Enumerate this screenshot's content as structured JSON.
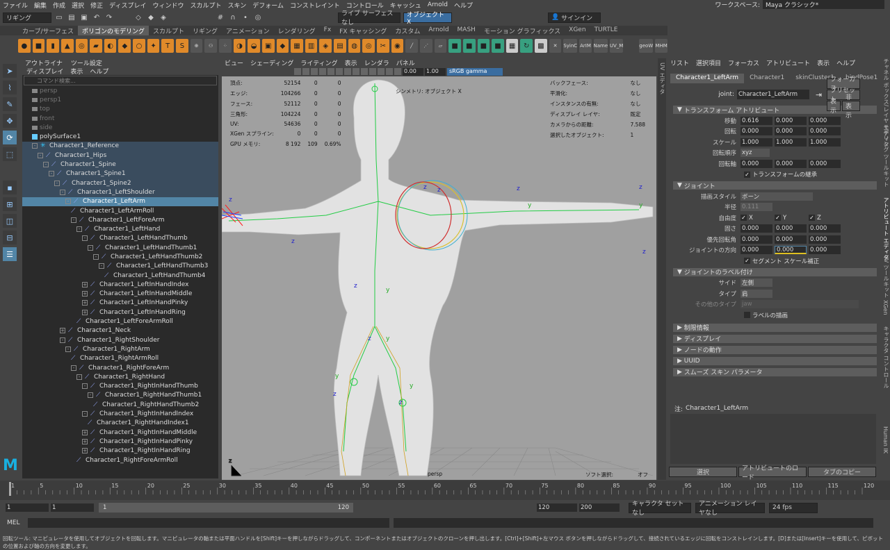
{
  "menubar": {
    "items": [
      "ファイル",
      "編集",
      "作成",
      "選択",
      "修正",
      "ディスプレイ",
      "ウィンドウ",
      "スカルプト",
      "スキン",
      "デフォーム",
      "コンストレイント",
      "コントロール",
      "キャッシュ",
      "Arnold",
      "ヘルプ"
    ],
    "workspace_label": "ワークスペース:",
    "workspace_value": "Maya クラシック*"
  },
  "statusline": {
    "mode": "リギング",
    "live_surface": "ライブ サーフェスなし",
    "symmetry": "オブジェクト X",
    "sign_in": "サインイン"
  },
  "shelf": {
    "tabs": [
      "カーブ/サーフェス",
      "ポリゴンのモデリング",
      "スカルプト",
      "リギング",
      "アニメーション",
      "レンダリング",
      "Fx",
      "FX キャッシング",
      "カスタム",
      "Arnold",
      "MASH",
      "モーション グラフィックス",
      "XGen",
      "TURTLE"
    ],
    "active_tab": "ポリゴンのモデリング",
    "icon_labels": [
      "SyinC",
      "ArIM",
      "Name",
      "UV_M",
      "geoW",
      "MHM"
    ]
  },
  "outliner": {
    "tabs": [
      "アウトライナ",
      "ツール設定"
    ],
    "menu": [
      "ディスプレイ",
      "表示",
      "ヘルプ"
    ],
    "search_placeholder": "コマンド検索...",
    "items": [
      {
        "label": "persp",
        "indent": 0,
        "type": "cam",
        "state": "gray"
      },
      {
        "label": "persp1",
        "indent": 0,
        "type": "cam",
        "state": "gray"
      },
      {
        "label": "top",
        "indent": 0,
        "type": "cam",
        "state": "gray"
      },
      {
        "label": "front",
        "indent": 0,
        "type": "cam",
        "state": "gray"
      },
      {
        "label": "side",
        "indent": 0,
        "type": "cam",
        "state": "gray"
      },
      {
        "label": "polySurface1",
        "indent": 0,
        "type": "mesh",
        "state": ""
      },
      {
        "label": "Character1_Reference",
        "indent": 0,
        "type": "ref",
        "state": "hl",
        "exp": "-"
      },
      {
        "label": "Character1_Hips",
        "indent": 1,
        "type": "jnt",
        "state": "hl",
        "exp": "-"
      },
      {
        "label": "Character1_Spine",
        "indent": 2,
        "type": "jnt",
        "state": "hl",
        "exp": "-"
      },
      {
        "label": "Character1_Spine1",
        "indent": 3,
        "type": "jnt",
        "state": "hl",
        "exp": "-"
      },
      {
        "label": "Character1_Spine2",
        "indent": 4,
        "type": "jnt",
        "state": "hl",
        "exp": "-"
      },
      {
        "label": "Character1_LeftShoulder",
        "indent": 5,
        "type": "jnt",
        "state": "hl",
        "exp": "-"
      },
      {
        "label": "Character1_LeftArm",
        "indent": 6,
        "type": "jnt",
        "state": "sel",
        "exp": "-"
      },
      {
        "label": "Character1_LeftArmRoll",
        "indent": 7,
        "type": "jnt",
        "state": "",
        "exp": ""
      },
      {
        "label": "Character1_LeftForeArm",
        "indent": 7,
        "type": "jnt",
        "state": "",
        "exp": "-"
      },
      {
        "label": "Character1_LeftHand",
        "indent": 8,
        "type": "jnt",
        "state": "",
        "exp": "-"
      },
      {
        "label": "Character1_LeftHandThumb",
        "indent": 9,
        "type": "jnt",
        "state": "",
        "exp": "-"
      },
      {
        "label": "Character1_LeftHandThumb1",
        "indent": 10,
        "type": "jnt",
        "state": "",
        "exp": "-"
      },
      {
        "label": "Character1_LeftHandThumb2",
        "indent": 11,
        "type": "jnt",
        "state": "",
        "exp": "-"
      },
      {
        "label": "Character1_LeftHandThumb3",
        "indent": 12,
        "type": "jnt",
        "state": "",
        "exp": "-"
      },
      {
        "label": "Character1_LeftHandThumb4",
        "indent": 13,
        "type": "jnt",
        "state": "",
        "exp": ""
      },
      {
        "label": "Character1_LeftInHandIndex",
        "indent": 9,
        "type": "jnt",
        "state": "",
        "exp": "+"
      },
      {
        "label": "Character1_LeftInHandMiddle",
        "indent": 9,
        "type": "jnt",
        "state": "",
        "exp": "+"
      },
      {
        "label": "Character1_LeftInHandPinky",
        "indent": 9,
        "type": "jnt",
        "state": "",
        "exp": "+"
      },
      {
        "label": "Character1_LeftInHandRing",
        "indent": 9,
        "type": "jnt",
        "state": "",
        "exp": "+"
      },
      {
        "label": "Character1_LeftForeArmRoll",
        "indent": 8,
        "type": "jnt",
        "state": "",
        "exp": ""
      },
      {
        "label": "Character1_Neck",
        "indent": 5,
        "type": "jnt",
        "state": "",
        "exp": "+"
      },
      {
        "label": "Character1_RightShoulder",
        "indent": 5,
        "type": "jnt",
        "state": "",
        "exp": "-"
      },
      {
        "label": "Character1_RightArm",
        "indent": 6,
        "type": "jnt",
        "state": "",
        "exp": "-"
      },
      {
        "label": "Character1_RightArmRoll",
        "indent": 7,
        "type": "jnt",
        "state": "",
        "exp": ""
      },
      {
        "label": "Character1_RightForeArm",
        "indent": 7,
        "type": "jnt",
        "state": "",
        "exp": "-"
      },
      {
        "label": "Character1_RightHand",
        "indent": 8,
        "type": "jnt",
        "state": "",
        "exp": "-"
      },
      {
        "label": "Character1_RightInHandThumb",
        "indent": 9,
        "type": "jnt",
        "state": "",
        "exp": "-"
      },
      {
        "label": "Character1_RightHandThumb1",
        "indent": 10,
        "type": "jnt",
        "state": "",
        "exp": "-"
      },
      {
        "label": "Character1_RightHandThumb2",
        "indent": 11,
        "type": "jnt",
        "state": "",
        "exp": ""
      },
      {
        "label": "Character1_RightInHandIndex",
        "indent": 9,
        "type": "jnt",
        "state": "",
        "exp": "-"
      },
      {
        "label": "Character1_RightHandIndex1",
        "indent": 10,
        "type": "jnt",
        "state": "",
        "exp": ""
      },
      {
        "label": "Character1_RightInHandMiddle",
        "indent": 9,
        "type": "jnt",
        "state": "",
        "exp": "+"
      },
      {
        "label": "Character1_RightInHandPinky",
        "indent": 9,
        "type": "jnt",
        "state": "",
        "exp": "+"
      },
      {
        "label": "Character1_RightInHandRing",
        "indent": 9,
        "type": "jnt",
        "state": "",
        "exp": "+"
      },
      {
        "label": "Character1_RightForeArmRoll",
        "indent": 8,
        "type": "jnt",
        "state": "",
        "exp": ""
      }
    ]
  },
  "viewport": {
    "menu": [
      "ビュー",
      "シェーディング",
      "ライティング",
      "表示",
      "レンダラ",
      "パネル"
    ],
    "near": "0.00",
    "far": "1.00",
    "color_space": "sRGB gamma",
    "camera_label": "persp",
    "soft_select": "ソフト選択:",
    "soft_value": "オフ",
    "symmetry_hud": "シンメトリ: オブジェクト X",
    "hud_left": [
      [
        "頂点:",
        "52154",
        "0",
        "0"
      ],
      [
        "エッジ:",
        "104266",
        "0",
        "0"
      ],
      [
        "フェース:",
        "52112",
        "0",
        "0"
      ],
      [
        "三角形:",
        "104224",
        "0",
        "0"
      ],
      [
        "UV:",
        "54636",
        "0",
        "0"
      ],
      [
        "XGen スプライン:",
        "0",
        "0",
        "0"
      ],
      [
        "GPU メモリ:",
        "8 192",
        "109",
        "0.69%"
      ]
    ],
    "hud_right": [
      [
        "バックフェース:",
        "なし"
      ],
      [
        "平滑化:",
        "なし"
      ],
      [
        "インスタンスの有無:",
        "なし"
      ],
      [
        "ディスプレイ レイヤ:",
        "既定"
      ],
      [
        "カメラからの距離:",
        "7.588"
      ],
      [
        "選択したオブジェクト:",
        "1"
      ]
    ]
  },
  "attr": {
    "menu": [
      "リスト",
      "選択項目",
      "フォーカス",
      "アトリビュート",
      "表示",
      "ヘルプ"
    ],
    "tabs": [
      "Character1_LeftArm",
      "Character1",
      "skinCluster1",
      "bindPose1"
    ],
    "joint_label": "joint:",
    "joint_value": "Character1_LeftArm",
    "btn_focus": "フォーカス",
    "btn_preset": "プリセット",
    "btn_show": "表示",
    "btn_hide": "非表示",
    "transform_header": "トランスフォーム アトリビュート",
    "translate": {
      "label": "移動",
      "values": [
        "0.616",
        "0.000",
        "0.000"
      ]
    },
    "rotate": {
      "label": "回転",
      "values": [
        "0.000",
        "0.000",
        "0.000"
      ]
    },
    "scale": {
      "label": "スケール",
      "values": [
        "1.000",
        "1.000",
        "1.000"
      ]
    },
    "rotate_order": {
      "label": "回転順序",
      "value": "xyz"
    },
    "rotate_axis": {
      "label": "回転軸",
      "values": [
        "0.000",
        "0.000",
        "0.000"
      ]
    },
    "inherits": "トランスフォームの継承",
    "joint_header": "ジョイント",
    "draw_style": {
      "label": "描画スタイル",
      "value": "ボーン"
    },
    "radius": {
      "label": "半径",
      "value": "0.111"
    },
    "dof": {
      "label": "自由度",
      "values": [
        "X",
        "Y",
        "Z"
      ]
    },
    "stiffness": {
      "label": "固さ",
      "values": [
        "0.000",
        "0.000",
        "0.000"
      ]
    },
    "pref_angle": {
      "label": "優先回転角",
      "values": [
        "0.000",
        "0.000",
        "0.000"
      ]
    },
    "joint_orient": {
      "label": "ジョイントの方向",
      "values": [
        "0.000",
        "0.000",
        "0.000"
      ]
    },
    "segment_scale": "セグメント スケール補正",
    "label_header": "ジョイントのラベル付け",
    "side": {
      "label": "サイド",
      "value": "左側"
    },
    "type": {
      "label": "タイプ",
      "value": "肩"
    },
    "other_type": {
      "label": "その他のタイプ",
      "value": "jaw"
    },
    "draw_label": "ラベルの描画",
    "collapsed": [
      "制限情報",
      "ディスプレイ",
      "ノードの動作",
      "UUID",
      "スムーズ スキン パラメータ"
    ],
    "note_label": "注:",
    "note_value": "Character1_LeftArm",
    "bottom_buttons": [
      "選択",
      "アトリビュートのロード",
      "タブのコピー"
    ],
    "side_tabs": [
      "チャネル ボックス/レイヤ エディタ",
      "モデリング ツールキット",
      "アトリビュート エディタ",
      "UV ツールキット",
      "XGen",
      "キャラクタ コントロール",
      "Human IK"
    ],
    "left_side_tab": "UV エディタ"
  },
  "timeline": {
    "ticks": [
      "1",
      "5",
      "10",
      "15",
      "20",
      "25",
      "30",
      "35",
      "40",
      "45",
      "50",
      "55",
      "60",
      "65",
      "70",
      "75",
      "80",
      "85",
      "90",
      "95",
      "100",
      "105",
      "110",
      "115",
      "120"
    ],
    "current": "1"
  },
  "range": {
    "start": "1",
    "anim_start": "1",
    "range_start": "1",
    "range_end": "120",
    "end": "120",
    "anim_end": "200",
    "char_set": "キャラクタ セットなし",
    "anim_layer": "アニメーション レイヤなし",
    "fps": "24 fps"
  },
  "cmdline": {
    "label": "MEL"
  },
  "help": "回転ツール: マニピュレータを使用してオブジェクトを回転します。マニピュレータの軸または平面ハンドルを[Shift]キーを押しながらドラッグして、コンポーネントまたはオブジェクトのクローンを押し出します。[Ctrl]+[Shift]+左マウス ボタンを押しながらドラッグして、接続されているエッジに回転をコンストレインします。[D]または[Insert]キーを使用して、ピボットの位置および軸の方向を変更します。",
  "colors": {
    "accent": "#5285a6",
    "orange": "#e08a2a",
    "panel": "#444444",
    "dark": "#2b2b2b",
    "viewport": "#a0a0a0"
  }
}
